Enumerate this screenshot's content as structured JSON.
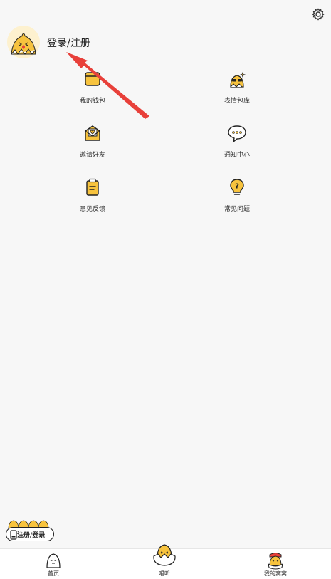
{
  "header": {
    "settings_icon": "gear-icon",
    "avatar_icon": "chick-avatar-icon",
    "login_label": "登录/注册"
  },
  "menu": {
    "items": [
      {
        "label": "我的钱包",
        "icon": "wallet-icon"
      },
      {
        "label": "表情包库",
        "icon": "sticker-library-icon"
      },
      {
        "label": "邀请好友",
        "icon": "invite-envelope-icon"
      },
      {
        "label": "通知中心",
        "icon": "notification-chat-icon"
      },
      {
        "label": "意见反馈",
        "icon": "feedback-clipboard-icon"
      },
      {
        "label": "常见问题",
        "icon": "question-bulb-icon"
      }
    ]
  },
  "floating_badge": {
    "label": "注册/登录"
  },
  "tabbar": {
    "tabs": [
      {
        "label": "首页",
        "icon": "home-chick-icon"
      },
      {
        "label": "唱听",
        "icon": "egg-chick-icon"
      },
      {
        "label": "我的窝窝",
        "icon": "nest-chick-icon"
      }
    ]
  },
  "colors": {
    "accent_yellow": "#f7c33e",
    "arrow_red": "#e8403a",
    "outline": "#222222"
  }
}
